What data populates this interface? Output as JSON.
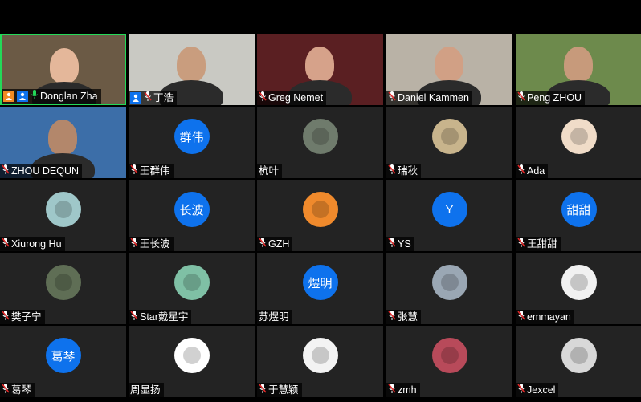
{
  "participants": [
    {
      "name": "Donglan Zha",
      "kind": "video",
      "active": true,
      "mic": "on",
      "badges": [
        "host",
        "pin"
      ],
      "bg": "#6b5a45",
      "skin": "#e4b79a"
    },
    {
      "name": "丁浩",
      "kind": "video",
      "mic": "muted",
      "badges": [
        "pin"
      ],
      "bg": "#c9c9c3",
      "skin": "#c99d7e"
    },
    {
      "name": "Greg Nemet",
      "kind": "video",
      "mic": "muted",
      "bg": "#5a1f22",
      "skin": "#d6a28a"
    },
    {
      "name": "Daniel Kammen",
      "kind": "video",
      "mic": "muted",
      "bg": "#b9b2a6",
      "skin": "#d1a085"
    },
    {
      "name": "Peng ZHOU",
      "kind": "video",
      "mic": "muted",
      "bg": "#6d8a4c",
      "skin": "#c79a7b"
    },
    {
      "name": "ZHOU DEQUN",
      "kind": "video",
      "mic": "muted",
      "bg": "#3c6ea8",
      "skin": "#b3876b"
    },
    {
      "name": "王群伟",
      "kind": "text",
      "avatar_text": "群伟",
      "mic": "off"
    },
    {
      "name": "杭叶",
      "kind": "img",
      "mic": "none",
      "avatar_color": "#6f7b6c"
    },
    {
      "name": "瑞秋",
      "kind": "img",
      "mic": "off",
      "avatar_color": "#c8b48c"
    },
    {
      "name": "Ada",
      "kind": "img",
      "mic": "off",
      "avatar_color": "#f0dcc8"
    },
    {
      "name": "Xiurong Hu",
      "kind": "img",
      "mic": "off",
      "avatar_color": "#9fc7c9"
    },
    {
      "name": "王长波",
      "kind": "text",
      "avatar_text": "长波",
      "mic": "off"
    },
    {
      "name": "GZH",
      "kind": "img",
      "mic": "off",
      "avatar_color": "#f08a2c"
    },
    {
      "name": "YS",
      "kind": "text",
      "avatar_text": "Y",
      "mic": "off"
    },
    {
      "name": "王甜甜",
      "kind": "text",
      "avatar_text": "甜甜",
      "mic": "off"
    },
    {
      "name": "樊子宁",
      "kind": "img",
      "mic": "off",
      "avatar_color": "#5f6e55"
    },
    {
      "name": "Star戴星宇",
      "kind": "img",
      "mic": "off",
      "avatar_color": "#7fc0a5"
    },
    {
      "name": "苏煜明",
      "kind": "text",
      "avatar_text": "煜明",
      "mic": "none"
    },
    {
      "name": "张慧",
      "kind": "img",
      "mic": "off",
      "avatar_color": "#9aa7b4"
    },
    {
      "name": "emmayan",
      "kind": "img",
      "mic": "off",
      "avatar_color": "#f1f1f1"
    },
    {
      "name": "葛琴",
      "kind": "text",
      "avatar_text": "葛琴",
      "mic": "off"
    },
    {
      "name": "周显扬",
      "kind": "img",
      "mic": "none",
      "avatar_color": "#ffffff"
    },
    {
      "name": "于慧颖",
      "kind": "img",
      "mic": "off",
      "avatar_color": "#f3f3f3"
    },
    {
      "name": "zmh",
      "kind": "img",
      "mic": "off",
      "avatar_color": "#b84a5a"
    },
    {
      "name": "Jexcel",
      "kind": "img",
      "mic": "off",
      "avatar_color": "#d8d8d8"
    }
  ],
  "colors": {
    "avatar_blue": "#0e72ed",
    "tile_bg": "#232323",
    "active_border": "#23d959",
    "mic_muted": "#e02828"
  }
}
